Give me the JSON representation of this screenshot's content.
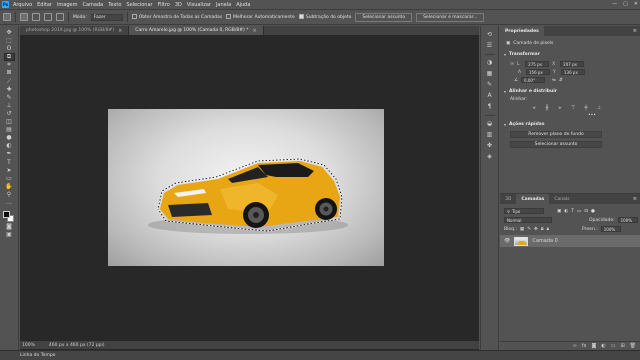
{
  "menu": {
    "logo": "Ps",
    "items": [
      "Arquivo",
      "Editar",
      "Imagem",
      "Camada",
      "Texto",
      "Selecionar",
      "Filtro",
      "3D",
      "Visualizar",
      "Janela",
      "Ajuda"
    ],
    "window_controls": [
      "—",
      "▢",
      "✕"
    ]
  },
  "options": {
    "mode_label": "Modo:",
    "mode_value": "Fazer",
    "sample_all_layers": "Obter Amostra de Todas as Camadas",
    "auto_enhance": "Melhorar Automaticamente",
    "subtract_object": "Subtração do objeto",
    "select_subject_btn": "Selecionar assunto",
    "select_and_mask_btn": "Selecionar e mascarar..."
  },
  "tabs": [
    {
      "label": "photoshop 2019.jpg @ 100% (RGB/8#)",
      "active": false
    },
    {
      "label": "Carro Amarelo.jpg @ 100% (Camada 0, RGB/8#) *",
      "active": true
    }
  ],
  "status": {
    "zoom": "100%",
    "doc_size": "460 px x 460 px (72 ppi)"
  },
  "timeline_label": "Linha do Tempo",
  "properties": {
    "tab_active": "Propriedades",
    "tab_inactive": "",
    "layer_type": "Camada de pixels",
    "transform_header": "Transformar",
    "w_label": "L",
    "w_value": "275 px",
    "h_label": "A",
    "h_value": "156 px",
    "x_label": "X",
    "x_value": "207 px",
    "y_label": "Y",
    "y_value": "136 px",
    "angle_value": "0,00°",
    "align_header": "Alinhar e distribuir",
    "align_sub": "Alinhar:",
    "more": "•••",
    "quick_actions_header": "Ações rápidas",
    "remove_bg_btn": "Remover plano de fundo",
    "select_subject_btn": "Selecionar assunto"
  },
  "layers": {
    "tab_3d": "3D",
    "tab_layers": "Camadas",
    "tab_channels": "Canais",
    "filter_kind": "Tipo",
    "blend_mode": "Normal",
    "opacity_label": "Opacidade:",
    "opacity_value": "100%",
    "lock_label": "Bloq.:",
    "fill_label": "Preen.:",
    "fill_value": "100%",
    "layer_name": "Camada 0"
  },
  "colors": {
    "car_body": "#e8a514",
    "selection": "#ffffff",
    "accent": "#31a8ff"
  }
}
